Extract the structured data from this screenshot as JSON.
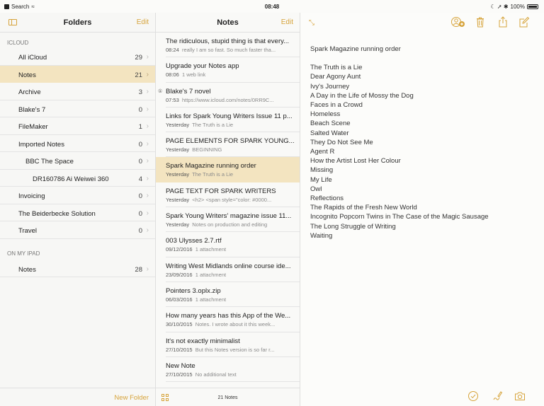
{
  "status": {
    "back_label": "Search",
    "wifi": "≈",
    "time": "08:48",
    "right_symbols": "☾ ➚ ✱",
    "battery": "100%"
  },
  "folders": {
    "title": "Folders",
    "edit_label": "Edit",
    "icloud_header": "ICLOUD",
    "icloud_items": [
      {
        "name": "All iCloud",
        "count": "29"
      },
      {
        "name": "Notes",
        "count": "21"
      },
      {
        "name": "Archive",
        "count": "3"
      },
      {
        "name": "Blake's 7",
        "count": "0"
      },
      {
        "name": "FileMaker",
        "count": "1"
      },
      {
        "name": "Imported Notes",
        "count": "0"
      },
      {
        "name": "BBC The Space",
        "count": "0"
      },
      {
        "name": "DR160786 Ai Weiwei 360",
        "count": "4"
      },
      {
        "name": "Invoicing",
        "count": "0"
      },
      {
        "name": "The Beiderbecke Solution",
        "count": "0"
      },
      {
        "name": "Travel",
        "count": "0"
      }
    ],
    "ipad_header": "ON MY IPAD",
    "ipad_items": [
      {
        "name": "Notes",
        "count": "28"
      }
    ],
    "new_folder_label": "New Folder",
    "chevron": "›"
  },
  "notes": {
    "title": "Notes",
    "edit_label": "Edit",
    "count_label": "21 Notes",
    "items": [
      {
        "title": "The ridiculous, stupid thing is that every...",
        "date": "08:24",
        "snippet": "really I am so fast. So much faster tha..."
      },
      {
        "title": "Upgrade your Notes app",
        "date": "08:06",
        "snippet": "1 web link"
      },
      {
        "title": "Blake's 7 novel",
        "date": "07:53",
        "snippet": "https://www.icloud.com/notes/0RR9C..."
      },
      {
        "title": "Links for Spark Young Writers Issue 11 p...",
        "date": "Yesterday",
        "snippet": "The Truth is a Lie"
      },
      {
        "title": "PAGE ELEMENTS FOR SPARK YOUNG...",
        "date": "Yesterday",
        "snippet": "BEGINNING"
      },
      {
        "title": "Spark Magazine running order",
        "date": "Yesterday",
        "snippet": "The Truth is a Lie"
      },
      {
        "title": "PAGE TEXT FOR SPARK WRITERS",
        "date": "Yesterday",
        "snippet": "<h2> <span style=\"color: #0000..."
      },
      {
        "title": "Spark Young Writers' magazine issue 11...",
        "date": "Yesterday",
        "snippet": "Notes on production and editing"
      },
      {
        "title": "003 Ulysses 2.7.rtf",
        "date": "09/12/2016",
        "snippet": "1 attachment"
      },
      {
        "title": "Writing West Midlands online course ide...",
        "date": "23/09/2016",
        "snippet": "1 attachment"
      },
      {
        "title": "Pointers 3.oplx.zip",
        "date": "06/03/2016",
        "snippet": "1 attachment"
      },
      {
        "title": "How many years has this App of the We...",
        "date": "30/10/2015",
        "snippet": "Notes. I wrote about it this week..."
      },
      {
        "title": "It's not exactly minimalist",
        "date": "27/10/2015",
        "snippet": "But this Notes version is so far r..."
      },
      {
        "title": "New Note",
        "date": "27/10/2015",
        "snippet": "No additional text"
      }
    ],
    "lock_glyph": "①"
  },
  "detail": {
    "expand_glyph": "⤡",
    "title": "Spark Magazine running order",
    "lines": [
      "The Truth is a Lie",
      "Dear Agony Aunt",
      "Ivy's Journey",
      "A Day in the Life of Mossy the Dog",
      "Faces in a Crowd",
      "Homeless",
      "Beach Scene",
      "Salted Water",
      "They Do Not See Me",
      "Agent R",
      "How the Artist Lost Her Colour",
      "Missing",
      "My Life",
      "Owl",
      "Reflections",
      "The Rapids of the Fresh New World",
      "Incognito Popcorn Twins in The Case of the Magic Sausage",
      "The Long Struggle of Writing",
      "Waiting"
    ]
  },
  "colors": {
    "accent": "#d6a33a",
    "selected": "#f3e4c0"
  }
}
